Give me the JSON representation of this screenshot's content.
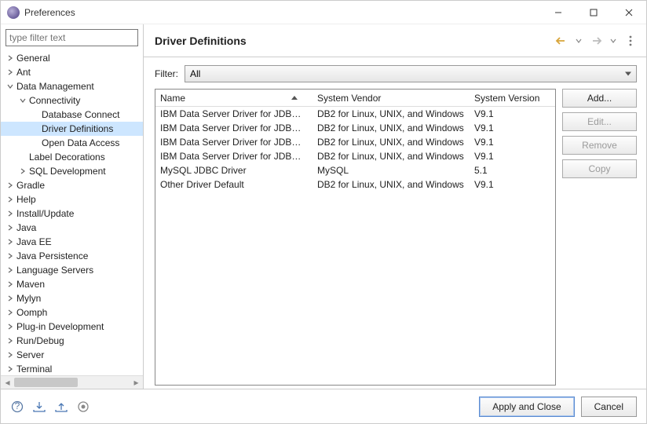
{
  "window": {
    "title": "Preferences"
  },
  "sidebar": {
    "filter_placeholder": "type filter text",
    "tree": [
      {
        "label": "General",
        "depth": 0,
        "expandable": true,
        "expanded": false,
        "selected": false
      },
      {
        "label": "Ant",
        "depth": 0,
        "expandable": true,
        "expanded": false,
        "selected": false
      },
      {
        "label": "Data Management",
        "depth": 0,
        "expandable": true,
        "expanded": true,
        "selected": false
      },
      {
        "label": "Connectivity",
        "depth": 1,
        "expandable": true,
        "expanded": true,
        "selected": false
      },
      {
        "label": "Database Connect",
        "depth": 2,
        "expandable": false,
        "expanded": false,
        "selected": false
      },
      {
        "label": "Driver Definitions",
        "depth": 2,
        "expandable": false,
        "expanded": false,
        "selected": true
      },
      {
        "label": "Open Data Access",
        "depth": 2,
        "expandable": false,
        "expanded": false,
        "selected": false
      },
      {
        "label": "Label Decorations",
        "depth": 1,
        "expandable": false,
        "expanded": false,
        "selected": false
      },
      {
        "label": "SQL Development",
        "depth": 1,
        "expandable": true,
        "expanded": false,
        "selected": false
      },
      {
        "label": "Gradle",
        "depth": 0,
        "expandable": true,
        "expanded": false,
        "selected": false
      },
      {
        "label": "Help",
        "depth": 0,
        "expandable": true,
        "expanded": false,
        "selected": false
      },
      {
        "label": "Install/Update",
        "depth": 0,
        "expandable": true,
        "expanded": false,
        "selected": false
      },
      {
        "label": "Java",
        "depth": 0,
        "expandable": true,
        "expanded": false,
        "selected": false
      },
      {
        "label": "Java EE",
        "depth": 0,
        "expandable": true,
        "expanded": false,
        "selected": false
      },
      {
        "label": "Java Persistence",
        "depth": 0,
        "expandable": true,
        "expanded": false,
        "selected": false
      },
      {
        "label": "Language Servers",
        "depth": 0,
        "expandable": true,
        "expanded": false,
        "selected": false
      },
      {
        "label": "Maven",
        "depth": 0,
        "expandable": true,
        "expanded": false,
        "selected": false
      },
      {
        "label": "Mylyn",
        "depth": 0,
        "expandable": true,
        "expanded": false,
        "selected": false
      },
      {
        "label": "Oomph",
        "depth": 0,
        "expandable": true,
        "expanded": false,
        "selected": false
      },
      {
        "label": "Plug-in Development",
        "depth": 0,
        "expandable": true,
        "expanded": false,
        "selected": false
      },
      {
        "label": "Run/Debug",
        "depth": 0,
        "expandable": true,
        "expanded": false,
        "selected": false
      },
      {
        "label": "Server",
        "depth": 0,
        "expandable": true,
        "expanded": false,
        "selected": false
      },
      {
        "label": "Terminal",
        "depth": 0,
        "expandable": true,
        "expanded": false,
        "selected": false
      }
    ]
  },
  "main": {
    "title": "Driver Definitions",
    "filter_label": "Filter:",
    "filter_value": "All",
    "columns": {
      "name": "Name",
      "vendor": "System Vendor",
      "version": "System Version"
    },
    "rows": [
      {
        "name": "IBM Data Server Driver for JDBC an...",
        "vendor": "DB2 for Linux, UNIX, and Windows",
        "version": "V9.1"
      },
      {
        "name": "IBM Data Server Driver for JDBC an...",
        "vendor": "DB2 for Linux, UNIX, and Windows",
        "version": "V9.1"
      },
      {
        "name": "IBM Data Server Driver for JDBC an...",
        "vendor": "DB2 for Linux, UNIX, and Windows",
        "version": "V9.1"
      },
      {
        "name": "IBM Data Server Driver for JDBC an...",
        "vendor": "DB2 for Linux, UNIX, and Windows",
        "version": "V9.1"
      },
      {
        "name": "MySQL JDBC Driver",
        "vendor": "MySQL",
        "version": "5.1"
      },
      {
        "name": "Other Driver Default",
        "vendor": "DB2 for Linux, UNIX, and Windows",
        "version": "V9.1"
      }
    ],
    "buttons": {
      "add": "Add...",
      "edit": "Edit...",
      "remove": "Remove",
      "copy": "Copy"
    }
  },
  "footer": {
    "apply": "Apply and Close",
    "cancel": "Cancel"
  }
}
